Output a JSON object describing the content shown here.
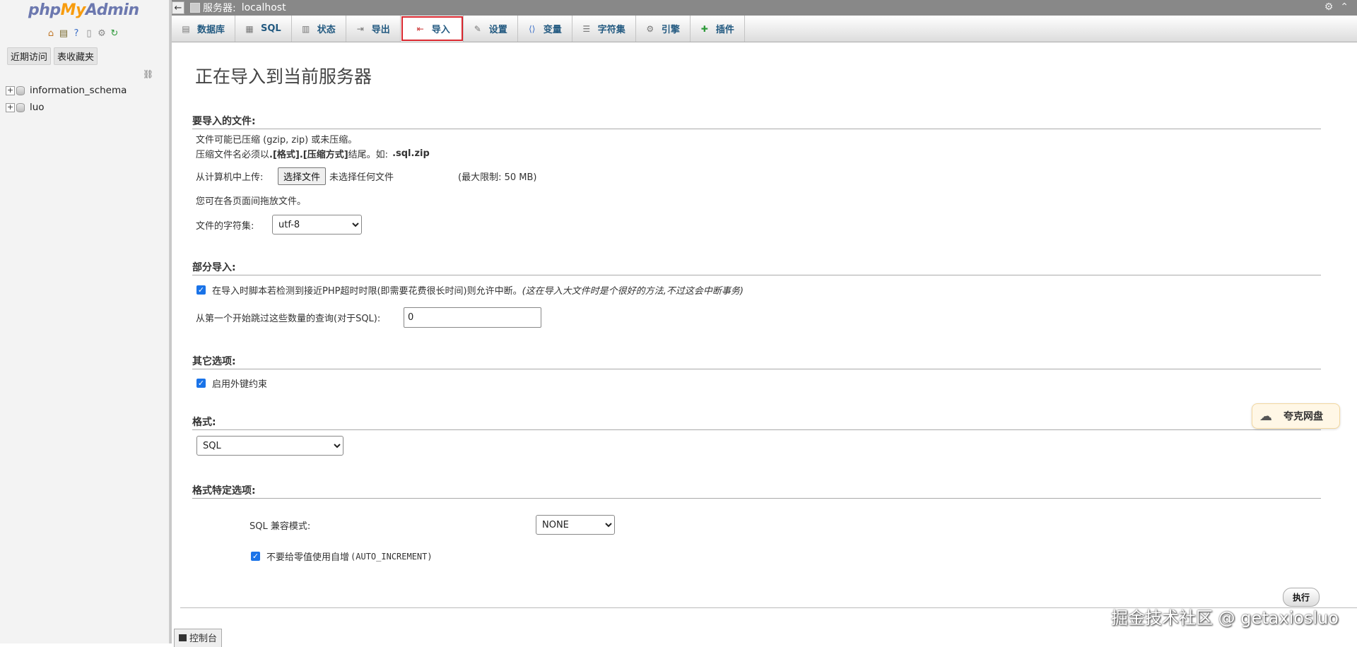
{
  "nav": {
    "logo_php": "php",
    "logo_my": "My",
    "logo_admin": "Admin",
    "icons": [
      "home-icon",
      "database-icon",
      "help-icon",
      "docs-icon",
      "settings-icon",
      "reload-icon"
    ],
    "recent_btn": "近期访问",
    "favorites_btn": "表收藏夹",
    "databases": [
      {
        "name": "information_schema"
      },
      {
        "name": "luo"
      }
    ]
  },
  "serverbar": {
    "label": "服务器:",
    "name": "localhost"
  },
  "tabs": [
    {
      "id": "databases",
      "label": "数据库",
      "icon": "database-icon"
    },
    {
      "id": "sql",
      "label": "SQL",
      "icon": "sql-icon"
    },
    {
      "id": "status",
      "label": "状态",
      "icon": "status-icon"
    },
    {
      "id": "export",
      "label": "导出",
      "icon": "export-icon"
    },
    {
      "id": "import",
      "label": "导入",
      "icon": "import-icon",
      "active": true
    },
    {
      "id": "settings",
      "label": "设置",
      "icon": "wrench-icon"
    },
    {
      "id": "variables",
      "label": "变量",
      "icon": "variables-icon"
    },
    {
      "id": "charsets",
      "label": "字符集",
      "icon": "charset-icon"
    },
    {
      "id": "engines",
      "label": "引擎",
      "icon": "engine-icon"
    },
    {
      "id": "plugins",
      "label": "插件",
      "icon": "plugin-icon"
    }
  ],
  "main": {
    "title": "正在导入到当前服务器",
    "file_section": {
      "header": "要导入的文件:",
      "compress_note": "文件可能已压缩 (gzip, zip) 或未压缩。",
      "ext_note_prefix": "压缩文件名必须以 ",
      "ext_note_bold": ".[格式].[压缩方式]",
      "ext_note_mid": " 结尾。如:",
      "ext_note_example": ".sql.zip",
      "upload_label": "从计算机中上传:",
      "choose_file_btn": "选择文件",
      "no_file_text": "未选择任何文件",
      "max_limit": "(最大限制: 50 MB)",
      "drag_note": "您可在各页面间拖放文件。",
      "charset_label": "文件的字符集:",
      "charset_value": "utf-8"
    },
    "partial_section": {
      "header": "部分导入:",
      "allow_interrupt_text": "在导入时脚本若检测到接近PHP超时时限(即需要花费很长时间)则允许中断。",
      "allow_interrupt_hint": "(这在导入大文件时是个很好的方法,不过这会中断事务)",
      "skip_label": "从第一个开始跳过这些数量的查询(对于SQL):",
      "skip_value": "0"
    },
    "other_section": {
      "header": "其它选项:",
      "fk_label": "启用外键约束"
    },
    "format_section": {
      "header": "格式:",
      "format_value": "SQL"
    },
    "format_options_section": {
      "header": "格式特定选项:",
      "compat_label": "SQL 兼容模式:",
      "compat_value": "NONE",
      "no_auto_value_prefix": "不要给零值使用自增",
      "no_auto_value_mono": "(AUTO_INCREMENT)"
    },
    "go_btn": "执行"
  },
  "console": {
    "label": "控制台"
  },
  "quark": {
    "label": "夸克网盘"
  },
  "watermark": "掘金技术社区 @ getaxiosluo",
  "colors": {
    "accent": "#235a81",
    "active_tab_outline": "#d8262e",
    "checkbox": "#1a73e8",
    "serverbar": "#888888"
  }
}
